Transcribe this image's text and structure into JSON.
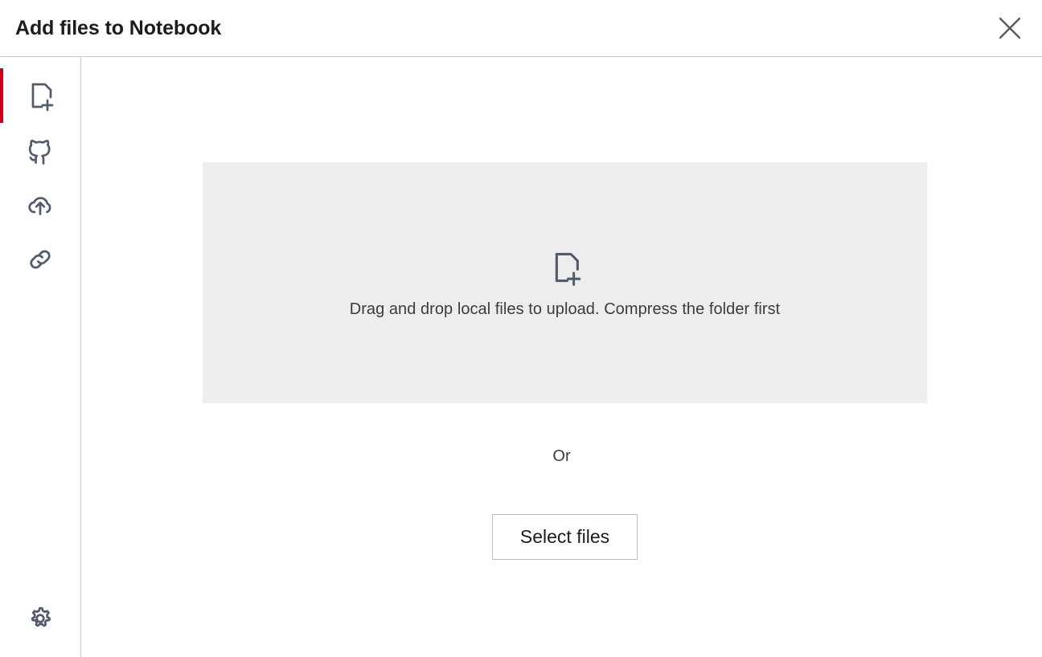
{
  "dialog": {
    "title": "Add files to Notebook",
    "close_label": "Close",
    "close_icon": "close-icon"
  },
  "sidebar": {
    "items": [
      {
        "id": "local-files",
        "icon": "file-plus-icon",
        "label": "Add local files",
        "active": true
      },
      {
        "id": "github",
        "icon": "github-icon",
        "label": "GitHub",
        "active": false
      },
      {
        "id": "cloud-upload",
        "icon": "cloud-upload-icon",
        "label": "Cloud upload",
        "active": false
      },
      {
        "id": "link",
        "icon": "link-icon",
        "label": "Add from URL",
        "active": false
      }
    ],
    "footer_items": [
      {
        "id": "settings",
        "icon": "gear-icon",
        "label": "Settings",
        "active": false
      }
    ]
  },
  "main": {
    "dropzone": {
      "icon": "file-plus-icon",
      "text": "Drag and drop local files to upload. Compress the folder first"
    },
    "or_label": "Or",
    "select_files_label": "Select files"
  },
  "colors": {
    "accent_red": "#c8001e",
    "icon_slate": "#525b6b",
    "dropzone_bg": "#ededed",
    "border": "#c6c8ca",
    "text": "#1c1c1c"
  }
}
